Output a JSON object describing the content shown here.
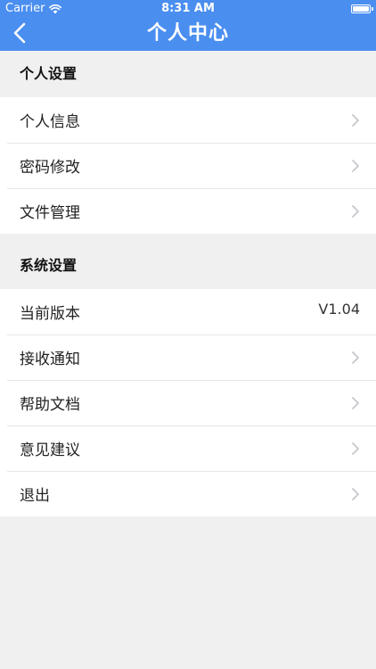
{
  "status_bar": {
    "carrier": "Carrier",
    "time": "8:31 AM"
  },
  "nav": {
    "title": "个人中心",
    "back_icon": "chevron-left-icon"
  },
  "sections": [
    {
      "header": "个人设置",
      "items": [
        {
          "label": "个人信息"
        },
        {
          "label": "密码修改"
        },
        {
          "label": "文件管理"
        }
      ]
    },
    {
      "header": "系统设置",
      "items": [
        {
          "label": "当前版本",
          "value": "V1.04"
        },
        {
          "label": "接收通知"
        },
        {
          "label": "帮助文档"
        },
        {
          "label": "意见建议"
        },
        {
          "label": "退出"
        }
      ]
    }
  ],
  "colors": {
    "accent": "#4a8ef0",
    "background": "#f0f0f0",
    "chevron": "#c7c7cc"
  }
}
